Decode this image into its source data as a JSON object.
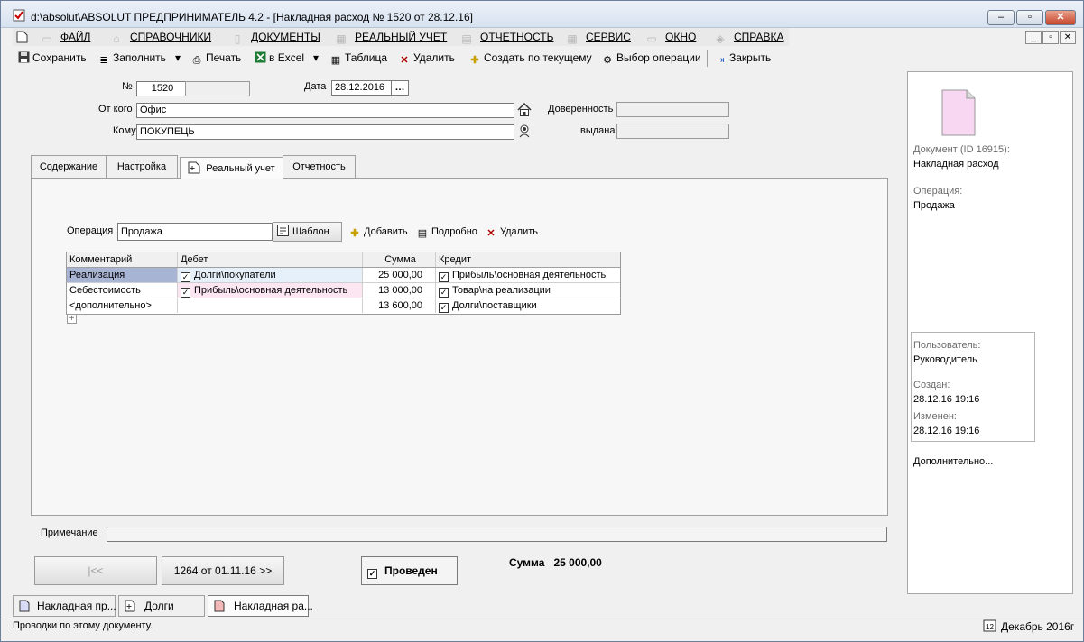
{
  "window": {
    "title": "d:\\absolut\\ABSOLUT  ПРЕДПРИНИМАТЕЛЬ 4.2 - [Накладная расход № 1520 от 28.12.16]"
  },
  "menu": [
    "ФАЙЛ",
    "СПРАВОЧНИКИ",
    "ДОКУМЕНТЫ",
    "РЕАЛЬНЫЙ УЧЕТ",
    "ОТЧЕТНОСТЬ",
    "СЕРВИС",
    "ОКНО",
    "СПРАВКА"
  ],
  "toolbar": {
    "save": "Сохранить",
    "fill": "Заполнить",
    "print": "Печать",
    "excel": "в Excel",
    "table": "Таблица",
    "delete": "Удалить",
    "create_from": "Создать по текущему",
    "select_op": "Выбор операции",
    "close": "Закрыть"
  },
  "header": {
    "num_label": "№",
    "num_value": "1520",
    "date_label": "Дата",
    "date_value": "28.12.2016",
    "date_btn": "…",
    "from_label": "От кого",
    "from_value": "Офис",
    "to_label": "Кому",
    "to_value": "ПОКУПЕЦЬ",
    "proxy_label": "Доверенность",
    "issued_label": "выдана"
  },
  "tabs": [
    "Содержание",
    "Настройка",
    "Реальный учет",
    "Отчетность"
  ],
  "operation": {
    "label": "Операция",
    "value": "Продажа",
    "template_btn": "Шаблон",
    "add_btn": "Добавить",
    "details_btn": "Подробно",
    "delete_btn": "Удалить"
  },
  "grid": {
    "columns": [
      "Комментарий",
      "Дебет",
      "Сумма",
      "Кредит"
    ],
    "rows": [
      {
        "comment": "Реализация",
        "debit": "Долги\\покупатели",
        "sum": "25 000,00",
        "credit": "Прибыль\\основная деятельность"
      },
      {
        "comment": "Себестоимость",
        "debit": "Прибыль\\основная деятельность",
        "sum": "13 000,00",
        "credit": "Товар\\на реализации"
      },
      {
        "comment": "<дополнительно>",
        "debit": "",
        "sum": "13 600,00",
        "credit": "Долги\\поставщики"
      }
    ]
  },
  "note_label": "Примечание",
  "nav": {
    "prev": "|<<",
    "next": "1264 от 01.11.16 >>"
  },
  "posted_label": "Проведен",
  "total_label": "Сумма",
  "total_value": "25 000,00",
  "sidebar": {
    "doc_label": "Документ  (ID 16915):",
    "doc_value": "Накладная расход",
    "op_label": "Операция:",
    "op_value": "Продажа",
    "user_label": "Пользователь:",
    "user_value": "Руководитель",
    "created_label": "Создан:",
    "created_value": "28.12.16  19:16",
    "modified_label": "Изменен:",
    "modified_value": "28.12.16  19:16",
    "more": "Дополнительно..."
  },
  "taskbar": [
    "Накладная пр...",
    "Долги",
    "Накладная ра..."
  ],
  "status": {
    "text": "Проводки по этому документу.",
    "period": "Декабрь 2016г"
  },
  "colors": {
    "selected_cell": "#a8b4d4",
    "debit_highlight": "#e6f0fa",
    "debit_pink": "#fbe6f2",
    "doc_icon": "#f8d7f2"
  }
}
